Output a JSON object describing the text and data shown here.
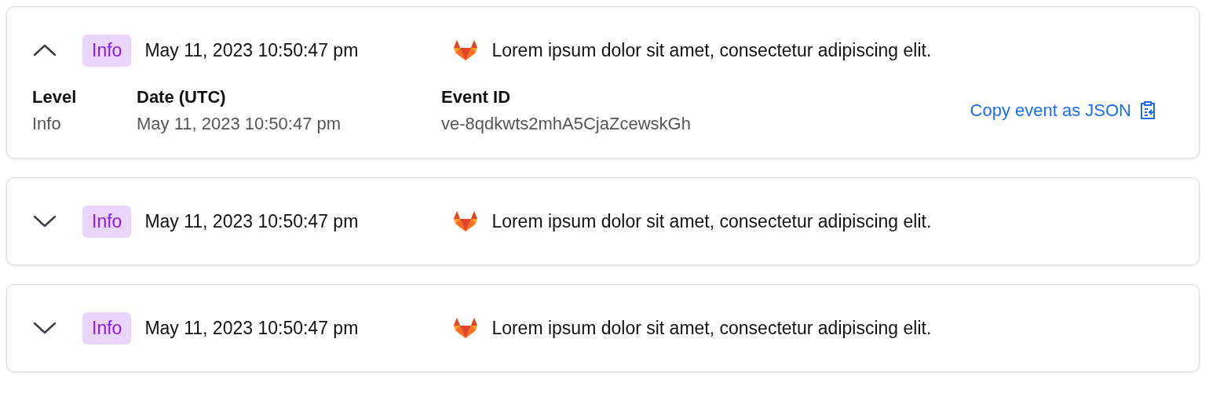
{
  "events": [
    {
      "expanded": true,
      "level": "Info",
      "timestamp": "May 11, 2023 10:50:47 pm",
      "message": "Lorem ipsum dolor sit amet, consectetur adipiscing elit.",
      "details": [
        {
          "label": "Level",
          "value": "Info"
        },
        {
          "label": "Date (UTC)",
          "value": "May 11, 2023 10:50:47 pm"
        },
        {
          "label": "Event ID",
          "value": "ve-8qdkwts2mhA5CjaZcewskGh"
        }
      ],
      "copy_link": "Copy event as JSON"
    },
    {
      "expanded": false,
      "level": "Info",
      "timestamp": "May 11, 2023 10:50:47 pm",
      "message": "Lorem ipsum dolor sit amet, consectetur adipiscing elit."
    },
    {
      "expanded": false,
      "level": "Info",
      "timestamp": "May 11, 2023 10:50:47 pm",
      "message": "Lorem ipsum dolor sit amet, consectetur adipiscing elit."
    }
  ]
}
